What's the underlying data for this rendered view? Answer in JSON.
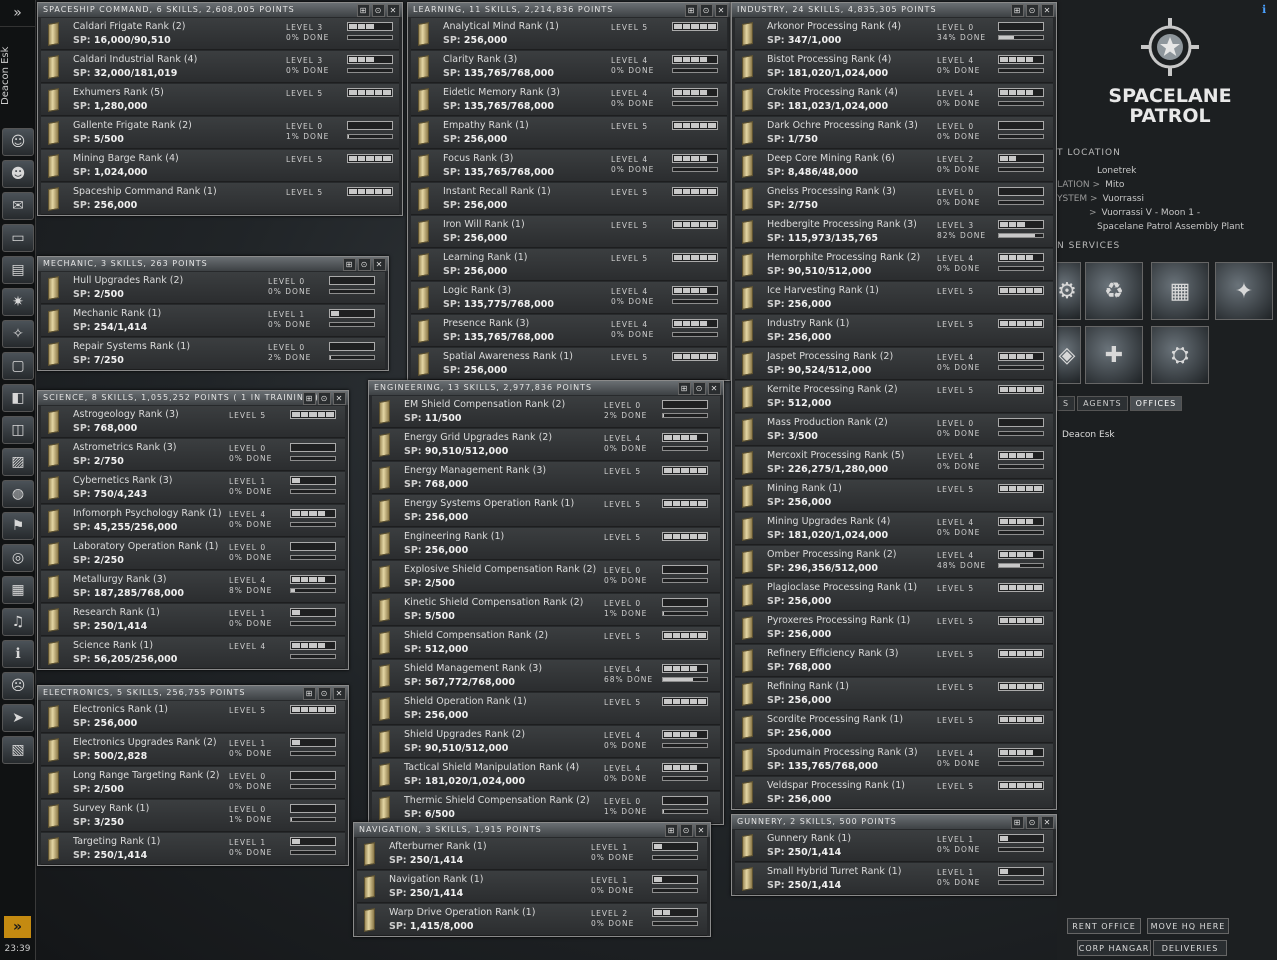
{
  "neocom": {
    "expand_glyph": "»",
    "character_name": "Deacon Esk",
    "icons": [
      "character-sheet-icon",
      "people-icon",
      "mail-icon",
      "notepad-icon",
      "market-icon",
      "map-icon",
      "starmap-icon",
      "journal-icon",
      "assets-icon",
      "wallet-icon",
      "corporation-icon",
      "help-icon",
      "fleet-icon",
      "science-icon",
      "contracts-icon",
      "audio-icon",
      "info-icon",
      "portrait-icon",
      "ship-icon",
      "items-icon"
    ],
    "bottom_glyph": "»",
    "clock": "23:39"
  },
  "station": {
    "logo_line1": "SPACELANE",
    "logo_line2": "PATROL",
    "location_header": "T LOCATION",
    "location": [
      {
        "label": "",
        "value": "Lonetrek"
      },
      {
        "label": "LATION >",
        "value": "Mito"
      },
      {
        "label": "YSTEM >",
        "value": "Vuorrassi"
      },
      {
        "label": ">",
        "value": "Vuorrassi V - Moon 1 -"
      },
      {
        "label": "",
        "value": "Spacelane Patrol Assembly Plant"
      }
    ],
    "services_header": "N SERVICES",
    "tabs": [
      "S",
      "AGENTS",
      "OFFICES"
    ],
    "agent_name": "Deacon Esk",
    "buttons": [
      "RENT OFFICE",
      "MOVE HQ HERE",
      "CORP HANGAR",
      "DELIVERIES"
    ]
  },
  "windows": [
    {
      "id": "spaceship-command",
      "title": "SPACESHIP COMMAND, 6 SKILLS, 2,608,005 POINTS",
      "skills": [
        {
          "name": "Caldari Frigate Rank (2)",
          "sp": "16,000/90,510",
          "level": "LEVEL 3",
          "done": "0% DONE",
          "lv": 3,
          "pr": 0
        },
        {
          "name": "Caldari Industrial Rank (4)",
          "sp": "32,000/181,019",
          "level": "LEVEL 3",
          "done": "0% DONE",
          "lv": 3,
          "pr": 0
        },
        {
          "name": "Exhumers Rank (5)",
          "sp": "1,280,000",
          "level": "LEVEL 5",
          "done": "",
          "lv": 5,
          "pr": null
        },
        {
          "name": "Gallente Frigate Rank (2)",
          "sp": "5/500",
          "level": "LEVEL 0",
          "done": "1% DONE",
          "lv": 0,
          "pr": 1
        },
        {
          "name": "Mining Barge Rank (4)",
          "sp": "1,024,000",
          "level": "LEVEL 5",
          "done": "",
          "lv": 5,
          "pr": null
        },
        {
          "name": "Spaceship Command Rank (1)",
          "sp": "256,000",
          "level": "LEVEL 5",
          "done": "",
          "lv": 5,
          "pr": null
        }
      ]
    },
    {
      "id": "mechanic",
      "title": "MECHANIC, 3 SKILLS, 263 POINTS",
      "skills": [
        {
          "name": "Hull Upgrades Rank (2)",
          "sp": "2/500",
          "level": "LEVEL 0",
          "done": "0% DONE",
          "lv": 0,
          "pr": 0
        },
        {
          "name": "Mechanic Rank (1)",
          "sp": "254/1,414",
          "level": "LEVEL 1",
          "done": "0% DONE",
          "lv": 1,
          "pr": 0
        },
        {
          "name": "Repair Systems Rank (1)",
          "sp": "7/250",
          "level": "LEVEL 0",
          "done": "2% DONE",
          "lv": 0,
          "pr": 2
        }
      ]
    },
    {
      "id": "science",
      "title": "SCIENCE, 8 SKILLS, 1,055,252 POINTS ( 1 IN TRAINING )",
      "skills": [
        {
          "name": "Astrogeology Rank (3)",
          "sp": "768,000",
          "level": "LEVEL 5",
          "done": "",
          "lv": 5,
          "pr": null
        },
        {
          "name": "Astrometrics Rank (3)",
          "sp": "2/750",
          "level": "LEVEL 0",
          "done": "0% DONE",
          "lv": 0,
          "pr": 0
        },
        {
          "name": "Cybernetics Rank (3)",
          "sp": "750/4,243",
          "level": "LEVEL 1",
          "done": "0% DONE",
          "lv": 1,
          "pr": 0
        },
        {
          "name": "Infomorph Psychology Rank (1)",
          "sp": "45,255/256,000",
          "level": "LEVEL 4",
          "done": "0% DONE",
          "lv": 4,
          "pr": 0
        },
        {
          "name": "Laboratory Operation Rank (1)",
          "sp": "2/250",
          "level": "LEVEL 0",
          "done": "0% DONE",
          "lv": 0,
          "pr": 0
        },
        {
          "name": "Metallurgy Rank (3)",
          "sp": "187,285/768,000",
          "level": "LEVEL 4",
          "done": "8% DONE",
          "lv": 4,
          "pr": 8
        },
        {
          "name": "Research Rank (1)",
          "sp": "250/1,414",
          "level": "LEVEL 1",
          "done": "0% DONE",
          "lv": 1,
          "pr": 0
        },
        {
          "name": "Science Rank (1)",
          "sp": "56,205/256,000",
          "level": "LEVEL 4",
          "done": "",
          "lv": 4,
          "pr": 0
        }
      ]
    },
    {
      "id": "electronics",
      "title": "ELECTRONICS, 5 SKILLS, 256,755 POINTS",
      "skills": [
        {
          "name": "Electronics Rank (1)",
          "sp": "256,000",
          "level": "LEVEL 5",
          "done": "",
          "lv": 5,
          "pr": null
        },
        {
          "name": "Electronics Upgrades Rank (2)",
          "sp": "500/2,828",
          "level": "LEVEL 1",
          "done": "0% DONE",
          "lv": 1,
          "pr": 0
        },
        {
          "name": "Long Range Targeting Rank (2)",
          "sp": "2/500",
          "level": "LEVEL 0",
          "done": "0% DONE",
          "lv": 0,
          "pr": 0
        },
        {
          "name": "Survey Rank (1)",
          "sp": "3/250",
          "level": "LEVEL 0",
          "done": "1% DONE",
          "lv": 0,
          "pr": 1
        },
        {
          "name": "Targeting Rank (1)",
          "sp": "250/1,414",
          "level": "LEVEL 1",
          "done": "0% DONE",
          "lv": 1,
          "pr": 0
        }
      ]
    },
    {
      "id": "learning",
      "title": "LEARNING, 11 SKILLS, 2,214,836 POINTS",
      "skills": [
        {
          "name": "Analytical Mind Rank (1)",
          "sp": "256,000",
          "level": "LEVEL 5",
          "done": "",
          "lv": 5,
          "pr": null
        },
        {
          "name": "Clarity Rank (3)",
          "sp": "135,765/768,000",
          "level": "LEVEL 4",
          "done": "0% DONE",
          "lv": 4,
          "pr": 0
        },
        {
          "name": "Eidetic Memory Rank (3)",
          "sp": "135,765/768,000",
          "level": "LEVEL 4",
          "done": "0% DONE",
          "lv": 4,
          "pr": 0
        },
        {
          "name": "Empathy Rank (1)",
          "sp": "256,000",
          "level": "LEVEL 5",
          "done": "",
          "lv": 5,
          "pr": null
        },
        {
          "name": "Focus Rank (3)",
          "sp": "135,765/768,000",
          "level": "LEVEL 4",
          "done": "0% DONE",
          "lv": 4,
          "pr": 0
        },
        {
          "name": "Instant Recall Rank (1)",
          "sp": "256,000",
          "level": "LEVEL 5",
          "done": "",
          "lv": 5,
          "pr": null
        },
        {
          "name": "Iron Will Rank (1)",
          "sp": "256,000",
          "level": "LEVEL 5",
          "done": "",
          "lv": 5,
          "pr": null
        },
        {
          "name": "Learning Rank (1)",
          "sp": "256,000",
          "level": "LEVEL 5",
          "done": "",
          "lv": 5,
          "pr": null
        },
        {
          "name": "Logic Rank (3)",
          "sp": "135,775/768,000",
          "level": "LEVEL 4",
          "done": "0% DONE",
          "lv": 4,
          "pr": 0
        },
        {
          "name": "Presence Rank (3)",
          "sp": "135,765/768,000",
          "level": "LEVEL 4",
          "done": "0% DONE",
          "lv": 4,
          "pr": 0
        },
        {
          "name": "Spatial Awareness Rank (1)",
          "sp": "256,000",
          "level": "LEVEL 5",
          "done": "",
          "lv": 5,
          "pr": null
        }
      ]
    },
    {
      "id": "engineering",
      "title": "ENGINEERING, 13 SKILLS, 2,977,836 POINTS",
      "skills": [
        {
          "name": "EM Shield Compensation Rank (2)",
          "sp": "11/500",
          "level": "LEVEL 0",
          "done": "2% DONE",
          "lv": 0,
          "pr": 2
        },
        {
          "name": "Energy Grid Upgrades Rank (2)",
          "sp": "90,510/512,000",
          "level": "LEVEL 4",
          "done": "0% DONE",
          "lv": 4,
          "pr": 0
        },
        {
          "name": "Energy Management Rank (3)",
          "sp": "768,000",
          "level": "LEVEL 5",
          "done": "",
          "lv": 5,
          "pr": null
        },
        {
          "name": "Energy Systems Operation Rank (1)",
          "sp": "256,000",
          "level": "LEVEL 5",
          "done": "",
          "lv": 5,
          "pr": null
        },
        {
          "name": "Engineering Rank (1)",
          "sp": "256,000",
          "level": "LEVEL 5",
          "done": "",
          "lv": 5,
          "pr": null
        },
        {
          "name": "Explosive Shield Compensation Rank (2)",
          "sp": "2/500",
          "level": "LEVEL 0",
          "done": "0% DONE",
          "lv": 0,
          "pr": 0
        },
        {
          "name": "Kinetic Shield Compensation Rank (2)",
          "sp": "5/500",
          "level": "LEVEL 0",
          "done": "1% DONE",
          "lv": 0,
          "pr": 1
        },
        {
          "name": "Shield Compensation Rank (2)",
          "sp": "512,000",
          "level": "LEVEL 5",
          "done": "",
          "lv": 5,
          "pr": null
        },
        {
          "name": "Shield Management Rank (3)",
          "sp": "567,772/768,000",
          "level": "LEVEL 4",
          "done": "68% DONE",
          "lv": 4,
          "pr": 68
        },
        {
          "name": "Shield Operation Rank (1)",
          "sp": "256,000",
          "level": "LEVEL 5",
          "done": "",
          "lv": 5,
          "pr": null
        },
        {
          "name": "Shield Upgrades Rank (2)",
          "sp": "90,510/512,000",
          "level": "LEVEL 4",
          "done": "0% DONE",
          "lv": 4,
          "pr": 0
        },
        {
          "name": "Tactical Shield Manipulation Rank (4)",
          "sp": "181,020/1,024,000",
          "level": "LEVEL 4",
          "done": "0% DONE",
          "lv": 4,
          "pr": 0
        },
        {
          "name": "Thermic Shield Compensation Rank (2)",
          "sp": "6/500",
          "level": "LEVEL 0",
          "done": "1% DONE",
          "lv": 0,
          "pr": 1
        }
      ]
    },
    {
      "id": "navigation",
      "title": "NAVIGATION, 3 SKILLS, 1,915 POINTS",
      "skills": [
        {
          "name": "Afterburner Rank (1)",
          "sp": "250/1,414",
          "level": "LEVEL 1",
          "done": "0% DONE",
          "lv": 1,
          "pr": 0
        },
        {
          "name": "Navigation Rank (1)",
          "sp": "250/1,414",
          "level": "LEVEL 1",
          "done": "0% DONE",
          "lv": 1,
          "pr": 0
        },
        {
          "name": "Warp Drive Operation Rank (1)",
          "sp": "1,415/8,000",
          "level": "LEVEL 2",
          "done": "0% DONE",
          "lv": 2,
          "pr": 0
        }
      ]
    },
    {
      "id": "industry",
      "title": "INDUSTRY, 24 SKILLS, 4,835,305 POINTS",
      "skills": [
        {
          "name": "Arkonor Processing Rank (4)",
          "sp": "347/1,000",
          "level": "LEVEL 0",
          "done": "34% DONE",
          "lv": 0,
          "pr": 34
        },
        {
          "name": "Bistot Processing Rank (4)",
          "sp": "181,020/1,024,000",
          "level": "LEVEL 4",
          "done": "0% DONE",
          "lv": 4,
          "pr": 0
        },
        {
          "name": "Crokite Processing Rank (4)",
          "sp": "181,023/1,024,000",
          "level": "LEVEL 4",
          "done": "0% DONE",
          "lv": 4,
          "pr": 0
        },
        {
          "name": "Dark Ochre Processing Rank (3)",
          "sp": "1/750",
          "level": "LEVEL 0",
          "done": "0% DONE",
          "lv": 0,
          "pr": 0
        },
        {
          "name": "Deep Core Mining Rank (6)",
          "sp": "8,486/48,000",
          "level": "LEVEL 2",
          "done": "0% DONE",
          "lv": 2,
          "pr": 0
        },
        {
          "name": "Gneiss Processing Rank (3)",
          "sp": "2/750",
          "level": "LEVEL 0",
          "done": "0% DONE",
          "lv": 0,
          "pr": 0
        },
        {
          "name": "Hedbergite Processing Rank (3)",
          "sp": "115,973/135,765",
          "level": "LEVEL 3",
          "done": "82% DONE",
          "lv": 3,
          "pr": 82
        },
        {
          "name": "Hemorphite Processing Rank (2)",
          "sp": "90,510/512,000",
          "level": "LEVEL 4",
          "done": "0% DONE",
          "lv": 4,
          "pr": 0
        },
        {
          "name": "Ice Harvesting Rank (1)",
          "sp": "256,000",
          "level": "LEVEL 5",
          "done": "",
          "lv": 5,
          "pr": null
        },
        {
          "name": "Industry Rank (1)",
          "sp": "256,000",
          "level": "LEVEL 5",
          "done": "",
          "lv": 5,
          "pr": null
        },
        {
          "name": "Jaspet Processing Rank (2)",
          "sp": "90,524/512,000",
          "level": "LEVEL 4",
          "done": "0% DONE",
          "lv": 4,
          "pr": 0
        },
        {
          "name": "Kernite Processing Rank (2)",
          "sp": "512,000",
          "level": "LEVEL 5",
          "done": "",
          "lv": 5,
          "pr": null
        },
        {
          "name": "Mass Production Rank (2)",
          "sp": "3/500",
          "level": "LEVEL 0",
          "done": "0% DONE",
          "lv": 0,
          "pr": 0
        },
        {
          "name": "Mercoxit Processing Rank (5)",
          "sp": "226,275/1,280,000",
          "level": "LEVEL 4",
          "done": "0% DONE",
          "lv": 4,
          "pr": 0
        },
        {
          "name": "Mining Rank (1)",
          "sp": "256,000",
          "level": "LEVEL 5",
          "done": "",
          "lv": 5,
          "pr": null
        },
        {
          "name": "Mining Upgrades Rank (4)",
          "sp": "181,020/1,024,000",
          "level": "LEVEL 4",
          "done": "0% DONE",
          "lv": 4,
          "pr": 0
        },
        {
          "name": "Omber Processing Rank (2)",
          "sp": "296,356/512,000",
          "level": "LEVEL 4",
          "done": "48% DONE",
          "lv": 4,
          "pr": 48
        },
        {
          "name": "Plagioclase Processing Rank (1)",
          "sp": "256,000",
          "level": "LEVEL 5",
          "done": "",
          "lv": 5,
          "pr": null
        },
        {
          "name": "Pyroxeres Processing Rank (1)",
          "sp": "256,000",
          "level": "LEVEL 5",
          "done": "",
          "lv": 5,
          "pr": null
        },
        {
          "name": "Refinery Efficiency Rank (3)",
          "sp": "768,000",
          "level": "LEVEL 5",
          "done": "",
          "lv": 5,
          "pr": null
        },
        {
          "name": "Refining Rank (1)",
          "sp": "256,000",
          "level": "LEVEL 5",
          "done": "",
          "lv": 5,
          "pr": null
        },
        {
          "name": "Scordite Processing Rank (1)",
          "sp": "256,000",
          "level": "LEVEL 5",
          "done": "",
          "lv": 5,
          "pr": null
        },
        {
          "name": "Spodumain Processing Rank (3)",
          "sp": "135,765/768,000",
          "level": "LEVEL 4",
          "done": "0% DONE",
          "lv": 4,
          "pr": 0
        },
        {
          "name": "Veldspar Processing Rank (1)",
          "sp": "256,000",
          "level": "LEVEL 5",
          "done": "",
          "lv": 5,
          "pr": null
        }
      ]
    },
    {
      "id": "gunnery",
      "title": "GUNNERY, 2 SKILLS, 500 POINTS",
      "skills": [
        {
          "name": "Gunnery Rank (1)",
          "sp": "250/1,414",
          "level": "LEVEL 1",
          "done": "0% DONE",
          "lv": 1,
          "pr": 0
        },
        {
          "name": "Small Hybrid Turret Rank (1)",
          "sp": "250/1,414",
          "level": "LEVEL 1",
          "done": "0% DONE",
          "lv": 1,
          "pr": 0
        }
      ]
    }
  ],
  "sp_label": "SP:",
  "window_controls": [
    "⊞",
    "⊙",
    "✕"
  ]
}
